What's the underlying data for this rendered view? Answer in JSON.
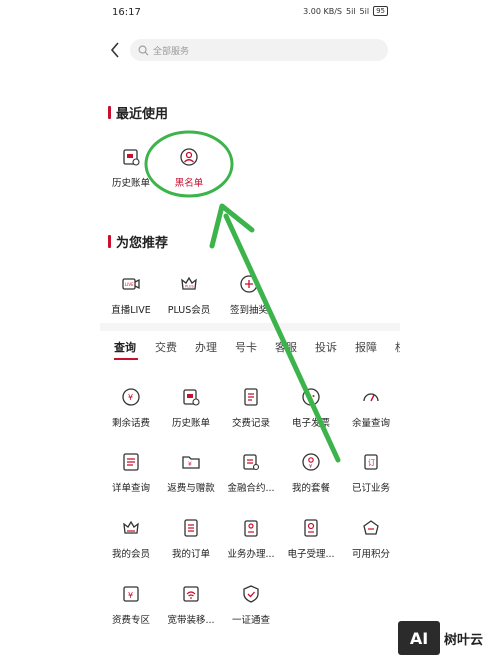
{
  "status": {
    "time": "16:17",
    "network": "3.00 KB/S",
    "signal1": "5il",
    "signal2": "5il",
    "battery": "95"
  },
  "header": {
    "search_placeholder": "全部服务"
  },
  "recent": {
    "title": "最近使用",
    "items": [
      {
        "label": "历史账单"
      },
      {
        "label": "黑名单"
      }
    ]
  },
  "recommend": {
    "title": "为您推荐",
    "items": [
      {
        "label": "直播LIVE"
      },
      {
        "label": "PLUS会员"
      },
      {
        "label": "签到抽奖"
      }
    ]
  },
  "tabs": [
    "查询",
    "交费",
    "办理",
    "号卡",
    "客服",
    "投诉",
    "报障",
    "权"
  ],
  "grid": {
    "rows": [
      [
        {
          "label": "剩余话费"
        },
        {
          "label": "历史账单"
        },
        {
          "label": "交费记录"
        },
        {
          "label": "电子发票"
        },
        {
          "label": "余量查询"
        }
      ],
      [
        {
          "label": "详单查询"
        },
        {
          "label": "返费与赠款"
        },
        {
          "label": "金融合约..."
        },
        {
          "label": "我的套餐"
        },
        {
          "label": "已订业务"
        }
      ],
      [
        {
          "label": "我的会员"
        },
        {
          "label": "我的订单"
        },
        {
          "label": "业务办理..."
        },
        {
          "label": "电子受理..."
        },
        {
          "label": "可用积分"
        }
      ],
      [
        {
          "label": "资费专区"
        },
        {
          "label": "宽带装移..."
        },
        {
          "label": "一证通查"
        }
      ]
    ]
  },
  "watermark": {
    "logo": "AI",
    "text": "树叶云"
  },
  "colors": {
    "accent": "#c8102e",
    "annotation": "#3cb44b"
  }
}
